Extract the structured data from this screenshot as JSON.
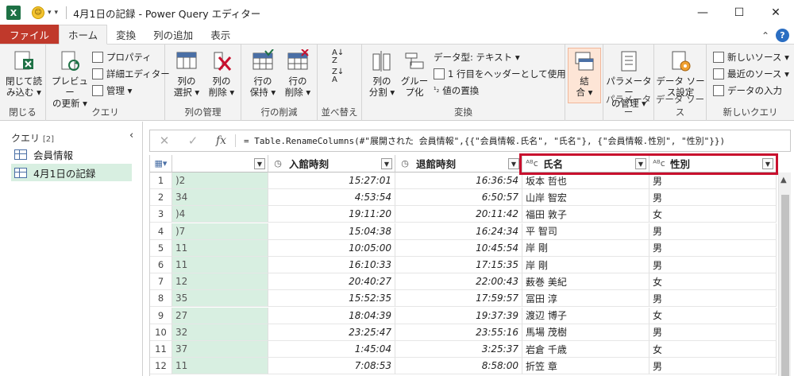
{
  "titlebar": {
    "app_icon": "X",
    "title": "4月1日の記録 - Power Query エディター",
    "minimize": "—",
    "maximize": "☐",
    "close": "✕"
  },
  "tabs": {
    "file": "ファイル",
    "home": "ホーム",
    "transform": "変換",
    "add_column": "列の追加",
    "view": "表示"
  },
  "ribbon": {
    "close_load": "閉じて読\nみ込む",
    "close_load_l1": "閉じて読",
    "close_load_l2": "み込む ▾",
    "group_close": "閉じる",
    "preview_l1": "プレビュー",
    "preview_l2": "の更新 ▾",
    "properties": "プロパティ",
    "advanced_editor": "詳細エディター",
    "manage": "管理 ▾",
    "group_query": "クエリ",
    "choose_cols_l1": "列の",
    "choose_cols_l2": "選択 ▾",
    "remove_cols_l1": "列の",
    "remove_cols_l2": "削除 ▾",
    "group_manage_cols": "列の管理",
    "keep_rows_l1": "行の",
    "keep_rows_l2": "保持 ▾",
    "remove_rows_l1": "行の",
    "remove_rows_l2": "削除 ▾",
    "group_reduce_rows": "行の削減",
    "group_sort": "並べ替え",
    "split_l1": "列の",
    "split_l2": "分割 ▾",
    "group_by_l1": "グルー",
    "group_by_l2": "プ化",
    "data_type": "データ型: テキスト ▾",
    "use_header": "1 行目をヘッダーとして使用 ▾",
    "replace_values": "値の置換",
    "group_transform": "変換",
    "combine_l1": "結",
    "combine_l2": "合 ▾",
    "params_l1": "パラメーター",
    "params_l2": "の管理 ▾",
    "group_params": "パラメーター",
    "source_settings_l1": "データ ソー",
    "source_settings_l2": "ス設定",
    "group_data_source": "データ ソース",
    "new_source": "新しいソース ▾",
    "recent_sources": "最近のソース ▾",
    "enter_data": "データの入力",
    "group_new_query": "新しいクエリ"
  },
  "query_pane": {
    "header": "クエリ",
    "count": "[2]",
    "items": [
      "会員情報",
      "4月1日の記録"
    ]
  },
  "formula_bar": {
    "cancel": "✕",
    "confirm": "✓",
    "fx": "fx",
    "formula": "= Table.RenameColumns(#\"展開された 会員情報\",{{\"会員情報.氏名\", \"氏名\"}, {\"会員情報.性別\", \"性別\"}})"
  },
  "table": {
    "columns": [
      {
        "name": "",
        "icon": ""
      },
      {
        "name": "入館時刻",
        "icon": "clock"
      },
      {
        "name": "退館時刻",
        "icon": "clock"
      },
      {
        "name": "氏名",
        "icon": "ABC"
      },
      {
        "name": "性別",
        "icon": "ABC"
      }
    ],
    "rows": [
      [
        "1",
        ")2",
        "15:27:01",
        "16:36:54",
        "坂本 哲也",
        "男"
      ],
      [
        "2",
        "34",
        "4:53:54",
        "6:50:57",
        "山岸 智宏",
        "男"
      ],
      [
        "3",
        ")4",
        "19:11:20",
        "20:11:42",
        "福田 敦子",
        "女"
      ],
      [
        "4",
        ")7",
        "15:04:38",
        "16:24:34",
        "平 智司",
        "男"
      ],
      [
        "5",
        "11",
        "10:05:00",
        "10:45:54",
        "岸 剛",
        "男"
      ],
      [
        "6",
        "11",
        "16:10:33",
        "17:15:35",
        "岸 剛",
        "男"
      ],
      [
        "7",
        "12",
        "20:40:27",
        "22:00:43",
        "薮巻 美紀",
        "女"
      ],
      [
        "8",
        "35",
        "15:52:35",
        "17:59:57",
        "冨田 淳",
        "男"
      ],
      [
        "9",
        "27",
        "18:04:39",
        "19:37:39",
        "渡辺 博子",
        "女"
      ],
      [
        "10",
        "32",
        "23:25:47",
        "23:55:16",
        "馬場 茂樹",
        "男"
      ],
      [
        "11",
        "37",
        "1:45:04",
        "3:25:37",
        "岩倉 千歳",
        "女"
      ],
      [
        "12",
        "11",
        "7:08:53",
        "8:58:00",
        "折笠 章",
        "男"
      ]
    ]
  },
  "colors": {
    "accent_red": "#c8102e",
    "selected_green": "#d8efe1",
    "file_tab": "#c0392b"
  }
}
